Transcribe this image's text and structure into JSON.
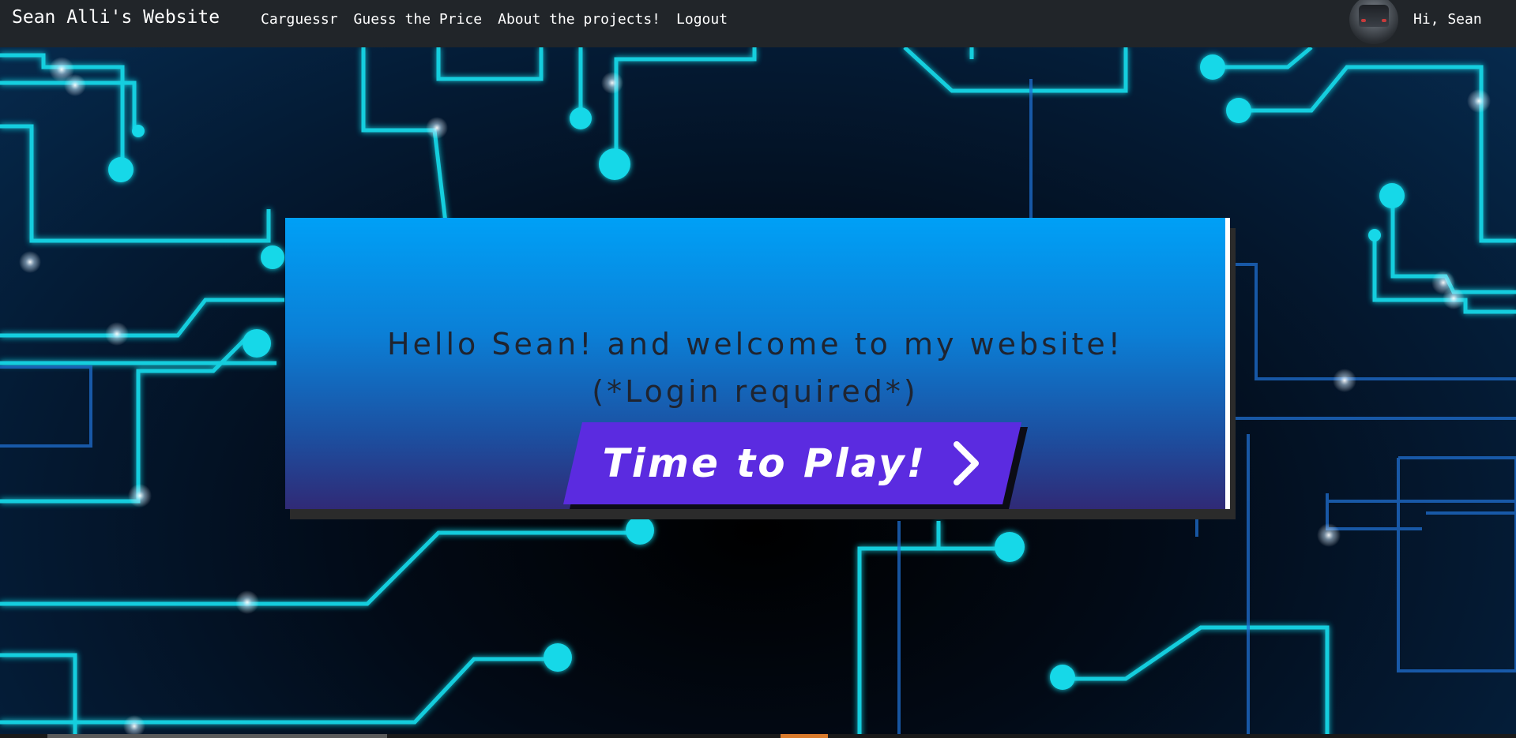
{
  "navbar": {
    "brand": "Sean Alli's Website",
    "links": [
      {
        "label": "Carguessr"
      },
      {
        "label": "Guess the Price"
      },
      {
        "label": "About the projects!"
      },
      {
        "label": "Logout"
      }
    ],
    "avatar_icon": "user-avatar-car-photo",
    "greeting": "Hi, Sean"
  },
  "hero": {
    "welcome_line1": "Hello Sean! and welcome to my website!",
    "welcome_line2": "(*Login required*)",
    "play_button_label": "Time to Play!",
    "play_button_icon": "chevron-right-icon"
  },
  "colors": {
    "navbar_bg": "#212529",
    "panel_top": "#00a0f6",
    "panel_bottom": "#302a76",
    "button_bg": "#5b2be0",
    "circuit": "#12d8e8"
  }
}
